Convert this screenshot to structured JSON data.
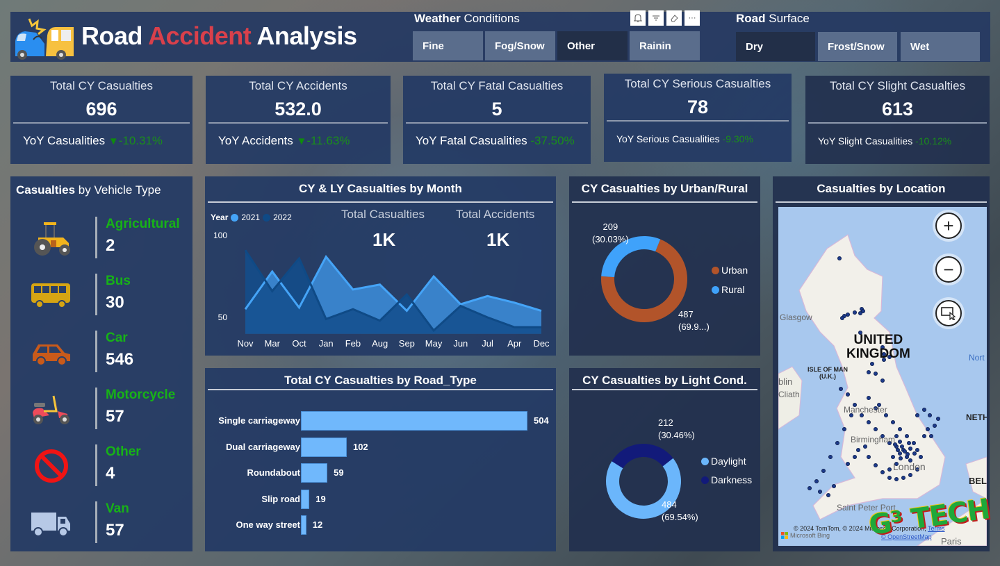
{
  "header": {
    "title_part1": "Road",
    "title_part2": "Accident",
    "title_part3": "Analysis",
    "accent_color": "#d9404b"
  },
  "weather_slicer": {
    "title_bold": "Weather",
    "title_rest": "Conditions",
    "options": [
      {
        "label": "Fine",
        "selected": true
      },
      {
        "label": "Fog/Snow",
        "selected": true
      },
      {
        "label": "Other",
        "selected": false
      },
      {
        "label": "Rainin",
        "selected": true
      }
    ]
  },
  "visual_toolbar": {
    "icons": [
      "bell-icon",
      "filter-icon",
      "eraser-icon",
      "more-options-icon"
    ],
    "more_label": "···"
  },
  "road_surface_slicer": {
    "title_bold": "Road",
    "title_rest": "Surface",
    "options": [
      {
        "label": "Dry",
        "selected": false
      },
      {
        "label": "Frost/Snow",
        "selected": true
      },
      {
        "label": "Wet",
        "selected": true
      }
    ]
  },
  "kpis": [
    {
      "title": "Total CY Casualties",
      "value": "696",
      "yoy_label": "YoY Casualities",
      "yoy_arrow": "▼",
      "yoy_value": "-10.31%"
    },
    {
      "title": "Total CY Accidents",
      "value": "532.0",
      "yoy_label": "YoY Accidents",
      "yoy_arrow": "▼",
      "yoy_value": "-11.63%"
    },
    {
      "title": "Total CY Fatal Casualties",
      "value": "5",
      "yoy_label": "YoY Fatal Casualities",
      "yoy_arrow": "",
      "yoy_value": "-37.50%"
    },
    {
      "title": "Total CY Serious Casualties",
      "value": "78",
      "yoy_label": "YoY Serious Casualities",
      "yoy_arrow": "",
      "yoy_value": "-9.30%"
    },
    {
      "title": "Total CY Slight Casualties",
      "value": "613",
      "yoy_label": "YoY Slight Casualities",
      "yoy_arrow": "",
      "yoy_value": "-10.12%"
    }
  ],
  "vehicle_panel": {
    "title_bold": "Casualties",
    "title_rest": "by Vehicle Type",
    "items": [
      {
        "label": "Agricultural",
        "value": "2",
        "icon": "tractor-icon"
      },
      {
        "label": "Bus",
        "value": "30",
        "icon": "bus-icon"
      },
      {
        "label": "Car",
        "value": "546",
        "icon": "car-icon"
      },
      {
        "label": "Motorcycle",
        "value": "57",
        "icon": "motorcycle-icon"
      },
      {
        "label": "Other",
        "value": "4",
        "icon": "prohibited-icon"
      },
      {
        "label": "Van",
        "value": "57",
        "icon": "van-icon"
      }
    ]
  },
  "month_panel": {
    "title": "CY & LY Casualties by Month",
    "legend_title": "Year",
    "total_casualties_label": "Total Casualties",
    "total_casualties_value": "1K",
    "total_accidents_label": "Total Accidents",
    "total_accidents_value": "1K"
  },
  "road_panel": {
    "title": "Total CY Casualties by Road_Type"
  },
  "urban_panel": {
    "title": "CY Casualties by Urban/Rural",
    "rural_label_value": "209",
    "rural_label_pct": "(30.03%)",
    "urban_label_value": "487",
    "urban_label_pct": "(69.9...)"
  },
  "light_panel": {
    "title": "CY Casualties by Light Cond.",
    "darkness_label_value": "212",
    "darkness_label_pct": "(30.46%)",
    "daylight_label_value": "484",
    "daylight_label_pct": "(69.54%)"
  },
  "map_panel": {
    "title": "Casualties by Location",
    "zoom_in_label": "+",
    "zoom_out_label": "−",
    "labels": {
      "glasgow": "Glasgow",
      "country_line1": "UNITED",
      "country_line2": "KINGDOM",
      "isle_of_man": "ISLE OF MAN",
      "isle_of_man_sub": "(U.K.)",
      "dublin": "blin",
      "bliath": "Cliath",
      "manchester": "Manchester",
      "birmingham": "Birmingham",
      "london": "London",
      "north": "Nort",
      "neth": "NETH",
      "bel": "BEL",
      "saint_peter_port": "Saint Peter Port",
      "paris": "Paris"
    },
    "attribution": "© 2024 TomTom, © 2024 Microsoft Corporation",
    "terms": "Terms",
    "osm": "© OpenStreetMap",
    "bing": "Microsoft Bing"
  },
  "watermark": "G³ TECH",
  "chart_data": [
    {
      "type": "area",
      "title": "CY & LY Casualties by Month",
      "categories": [
        "Nov",
        "Mar",
        "Oct",
        "Jan",
        "Feb",
        "Aug",
        "Sep",
        "May",
        "Jun",
        "Jul",
        "Apr",
        "Dec"
      ],
      "series": [
        {
          "name": "2021",
          "color": "#45a4f7",
          "values": [
            55,
            78,
            56,
            87,
            67,
            70,
            54,
            75,
            58,
            63,
            59,
            54
          ]
        },
        {
          "name": "2022",
          "color": "#0f4a86",
          "values": [
            91,
            66,
            86,
            49,
            55,
            48,
            64,
            42,
            57,
            50,
            44,
            44
          ]
        }
      ],
      "ylim": [
        40,
        100
      ],
      "yticks": [
        50,
        100
      ],
      "xlabel": "",
      "ylabel": "",
      "legend": "top-left"
    },
    {
      "type": "bar",
      "orientation": "horizontal",
      "title": "Total CY Casualties by Road_Type",
      "categories": [
        "Single carriageway",
        "Dual carriageway",
        "Roundabout",
        "Slip road",
        "One way street"
      ],
      "values": [
        504,
        102,
        59,
        19,
        12
      ],
      "color": "#70b8fc"
    },
    {
      "type": "pie",
      "variant": "donut",
      "title": "CY Casualties by Urban/Rural",
      "labels": [
        "Urban",
        "Rural"
      ],
      "values": [
        487,
        209
      ],
      "percents": [
        69.97,
        30.03
      ],
      "colors": [
        "#b2542a",
        "#3fa2fb"
      ],
      "legend": "right"
    },
    {
      "type": "pie",
      "variant": "donut",
      "title": "CY Casualties by Light Cond.",
      "labels": [
        "Daylight",
        "Darkness"
      ],
      "values": [
        484,
        212
      ],
      "percents": [
        69.54,
        30.46
      ],
      "colors": [
        "#6bb6fb",
        "#121a7a"
      ],
      "legend": "right"
    }
  ]
}
